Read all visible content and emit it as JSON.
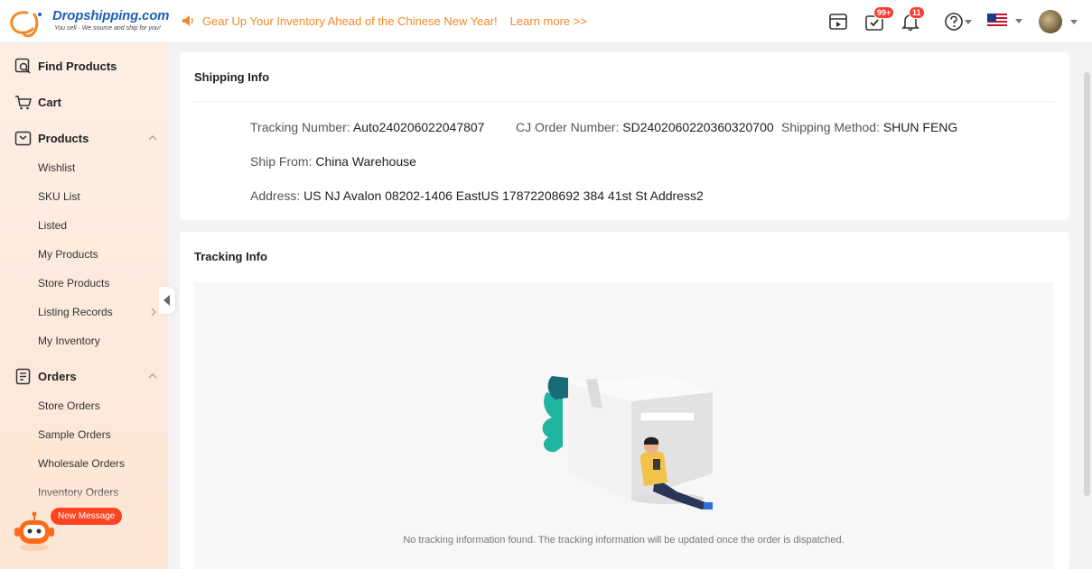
{
  "header": {
    "logo_text": "Dropshipping.com",
    "logo_tagline": "You sell · We source and ship for you!",
    "announcement": "Gear Up Your Inventory Ahead of the Chinese New Year!",
    "learn_more": "Learn more >>",
    "badges": {
      "tasks": "99+",
      "notifications": "11"
    }
  },
  "sidebar": {
    "find_products": "Find Products",
    "cart": "Cart",
    "products": "Products",
    "product_items": [
      "Wishlist",
      "SKU List",
      "Listed",
      "My Products",
      "Store Products",
      "Listing Records",
      "My Inventory"
    ],
    "orders": "Orders",
    "order_items": [
      "Store Orders",
      "Sample Orders",
      "Wholesale Orders",
      "Inventory Orders"
    ],
    "new_message": "New Message"
  },
  "shipping": {
    "title": "Shipping Info",
    "tracking_label": "Tracking Number:",
    "tracking_value": "Auto240206022047807",
    "order_label": "CJ Order Number:",
    "order_value": "SD2402060220360320700",
    "method_label": "Shipping Method:",
    "method_value": "SHUN FENG",
    "from_label": "Ship From:",
    "from_value": "China Warehouse",
    "address_label": "Address:",
    "address_value": "US NJ Avalon 08202-1406 EastUS 17872208692 384 41st St Address2"
  },
  "tracking": {
    "title": "Tracking Info",
    "empty_message": "No tracking information found. The tracking information will be updated once the order is dispatched."
  },
  "colors": {
    "accent": "#f08a2a",
    "brand_blue": "#1f5fb6",
    "badge_red": "#ff3d2e"
  },
  "icons": [
    "speaker-icon",
    "video-icon",
    "task-check-icon",
    "bell-icon",
    "help-icon",
    "us-flag-icon",
    "avatar"
  ]
}
